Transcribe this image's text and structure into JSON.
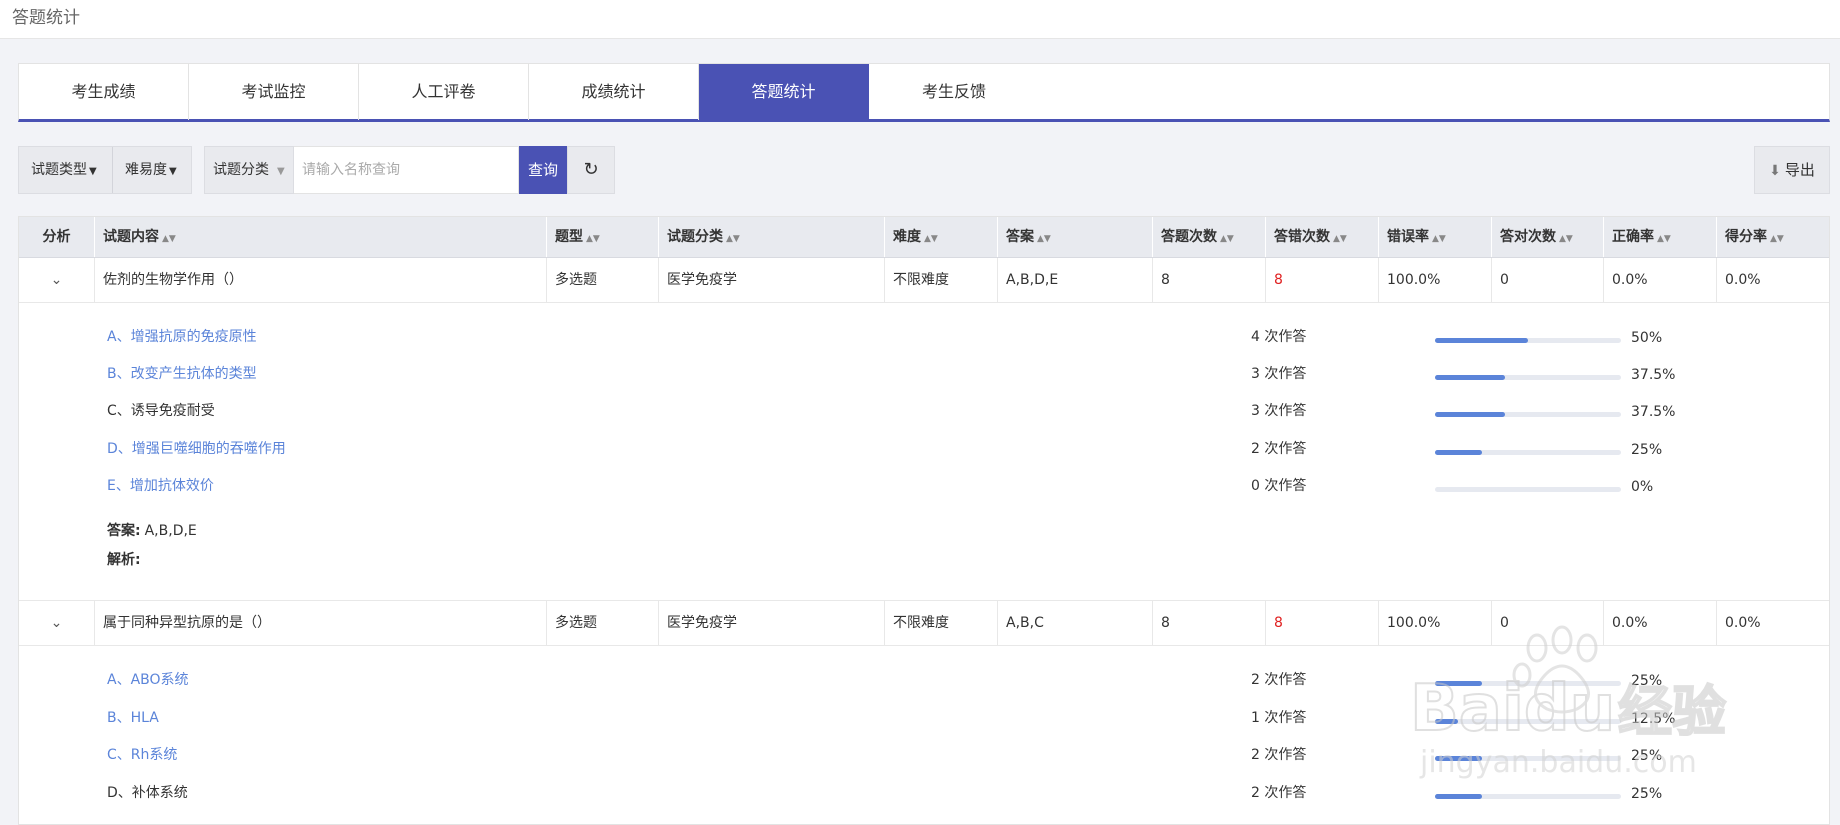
{
  "page_title": "答题统计",
  "tabs": [
    {
      "label": "考生成绩",
      "active": false
    },
    {
      "label": "考试监控",
      "active": false
    },
    {
      "label": "人工评卷",
      "active": false
    },
    {
      "label": "成绩统计",
      "active": false
    },
    {
      "label": "答题统计",
      "active": true
    },
    {
      "label": "考生反馈",
      "active": false
    }
  ],
  "filters": {
    "type_label": "试题类型",
    "difficulty_label": "难易度",
    "category_label": "试题分类",
    "search_placeholder": "请输入名称查询",
    "query_label": "查询",
    "export_label": "导出"
  },
  "columns": [
    "分析",
    "试题内容",
    "题型",
    "试题分类",
    "难度",
    "答案",
    "答题次数",
    "答错次数",
    "错误率",
    "答对次数",
    "正确率",
    "得分率"
  ],
  "answer_label": "答案:",
  "analysis_label": "解析:",
  "questions": [
    {
      "content": "佐剂的生物学作用（）",
      "type": "多选题",
      "category": "医学免疫学",
      "difficulty": "不限难度",
      "answer": "A,B,D,E",
      "attempts": "8",
      "wrong": "8",
      "error_rate": "100.0%",
      "correct": "0",
      "correct_rate": "0.0%",
      "score_rate": "0.0%",
      "options": [
        {
          "text": "A、增强抗原的免疫原性",
          "count": "4 次作答",
          "percent": "50%",
          "fraction": 0.5,
          "is_answer": true
        },
        {
          "text": "B、改变产生抗体的类型",
          "count": "3 次作答",
          "percent": "37.5%",
          "fraction": 0.375,
          "is_answer": true
        },
        {
          "text": "C、诱导免疫耐受",
          "count": "3 次作答",
          "percent": "37.5%",
          "fraction": 0.375,
          "is_answer": false
        },
        {
          "text": "D、增强巨噬细胞的吞噬作用",
          "count": "2 次作答",
          "percent": "25%",
          "fraction": 0.25,
          "is_answer": true
        },
        {
          "text": "E、增加抗体效价",
          "count": "0 次作答",
          "percent": "0%",
          "fraction": 0,
          "is_answer": true
        }
      ],
      "answer_value": "A,B,D,E",
      "analysis_value": ""
    },
    {
      "content": "属于同种异型抗原的是（）",
      "type": "多选题",
      "category": "医学免疫学",
      "difficulty": "不限难度",
      "answer": "A,B,C",
      "attempts": "8",
      "wrong": "8",
      "error_rate": "100.0%",
      "correct": "0",
      "correct_rate": "0.0%",
      "score_rate": "0.0%",
      "options": [
        {
          "text": "A、ABO系统",
          "count": "2 次作答",
          "percent": "25%",
          "fraction": 0.25,
          "is_answer": true
        },
        {
          "text": "B、HLA",
          "count": "1 次作答",
          "percent": "12.5%",
          "fraction": 0.125,
          "is_answer": true
        },
        {
          "text": "C、Rh系统",
          "count": "2 次作答",
          "percent": "25%",
          "fraction": 0.25,
          "is_answer": true
        },
        {
          "text": "D、补体系统",
          "count": "2 次作答",
          "percent": "25%",
          "fraction": 0.25,
          "is_answer": false
        }
      ]
    }
  ],
  "watermark": {
    "brand": "Baidu",
    "suffix": "经验",
    "url": "jingyan.baidu.com"
  },
  "colors": {
    "accent": "#4a52b4",
    "link": "#5b84d9",
    "error": "#e02020"
  }
}
